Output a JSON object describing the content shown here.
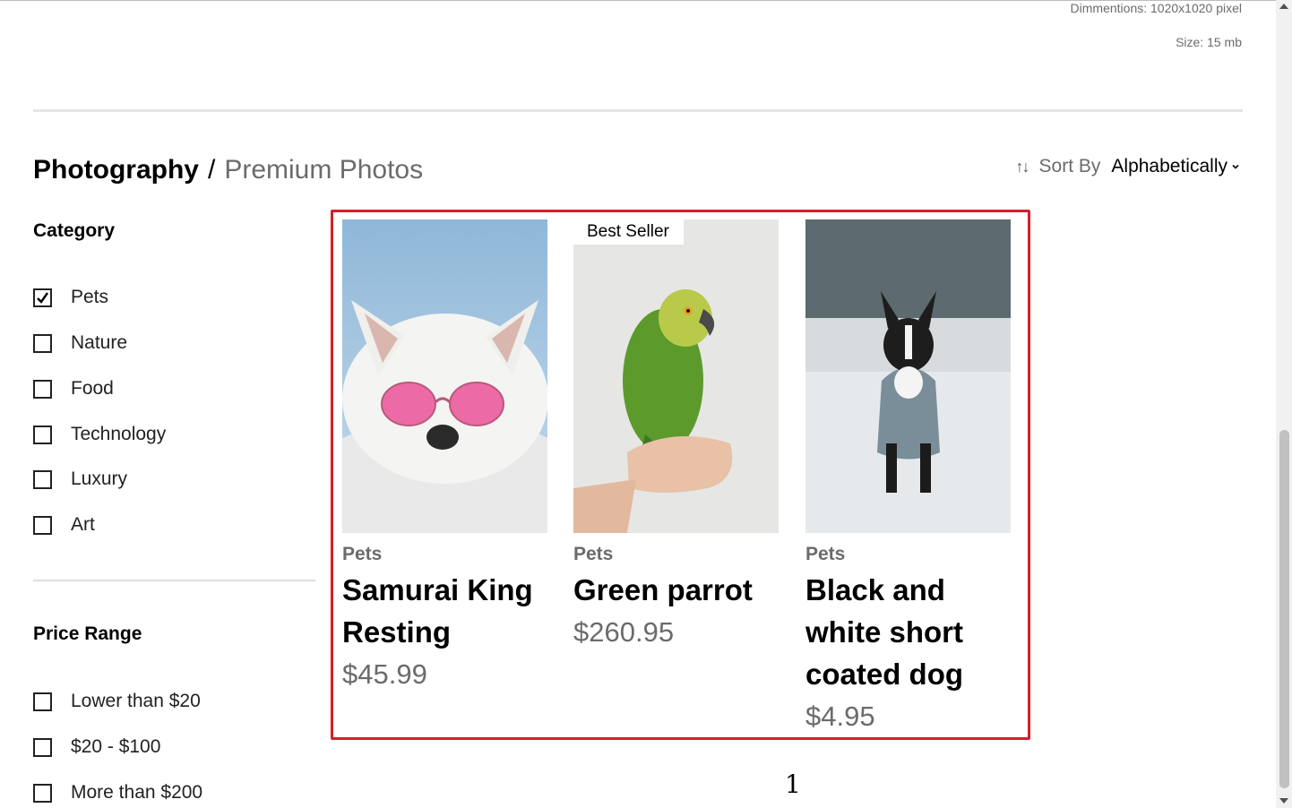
{
  "meta": {
    "dimensions": "Dimmentions: 1020x1020 pixel",
    "size": "Size: 15 mb"
  },
  "breadcrumb": {
    "main": "Photography",
    "separator": "/",
    "sub": "Premium Photos"
  },
  "sort": {
    "icon": "sort-arrows-icon",
    "label": "Sort By",
    "value": "Alphabetically"
  },
  "category": {
    "title": "Category",
    "items": [
      {
        "label": "Pets",
        "checked": true
      },
      {
        "label": "Nature",
        "checked": false
      },
      {
        "label": "Food",
        "checked": false
      },
      {
        "label": "Technology",
        "checked": false
      },
      {
        "label": "Luxury",
        "checked": false
      },
      {
        "label": "Art",
        "checked": false
      }
    ]
  },
  "price_range": {
    "title": "Price Range",
    "items": [
      {
        "label": "Lower than $20",
        "checked": false
      },
      {
        "label": "$20 - $100",
        "checked": false
      },
      {
        "label": "More than $200",
        "checked": false
      }
    ]
  },
  "products": [
    {
      "category": "Pets",
      "title": "Samurai King Resting",
      "price": "$45.99",
      "badge": ""
    },
    {
      "category": "Pets",
      "title": "Green parrot",
      "price": "$260.95",
      "badge": "Best Seller"
    },
    {
      "category": "Pets",
      "title": "Black and white short coated dog",
      "price": "$4.95",
      "badge": ""
    }
  ],
  "pagination": {
    "current": "1"
  },
  "colors": {
    "highlight_border": "#d41f2a",
    "muted_text": "#6b6b6b"
  }
}
